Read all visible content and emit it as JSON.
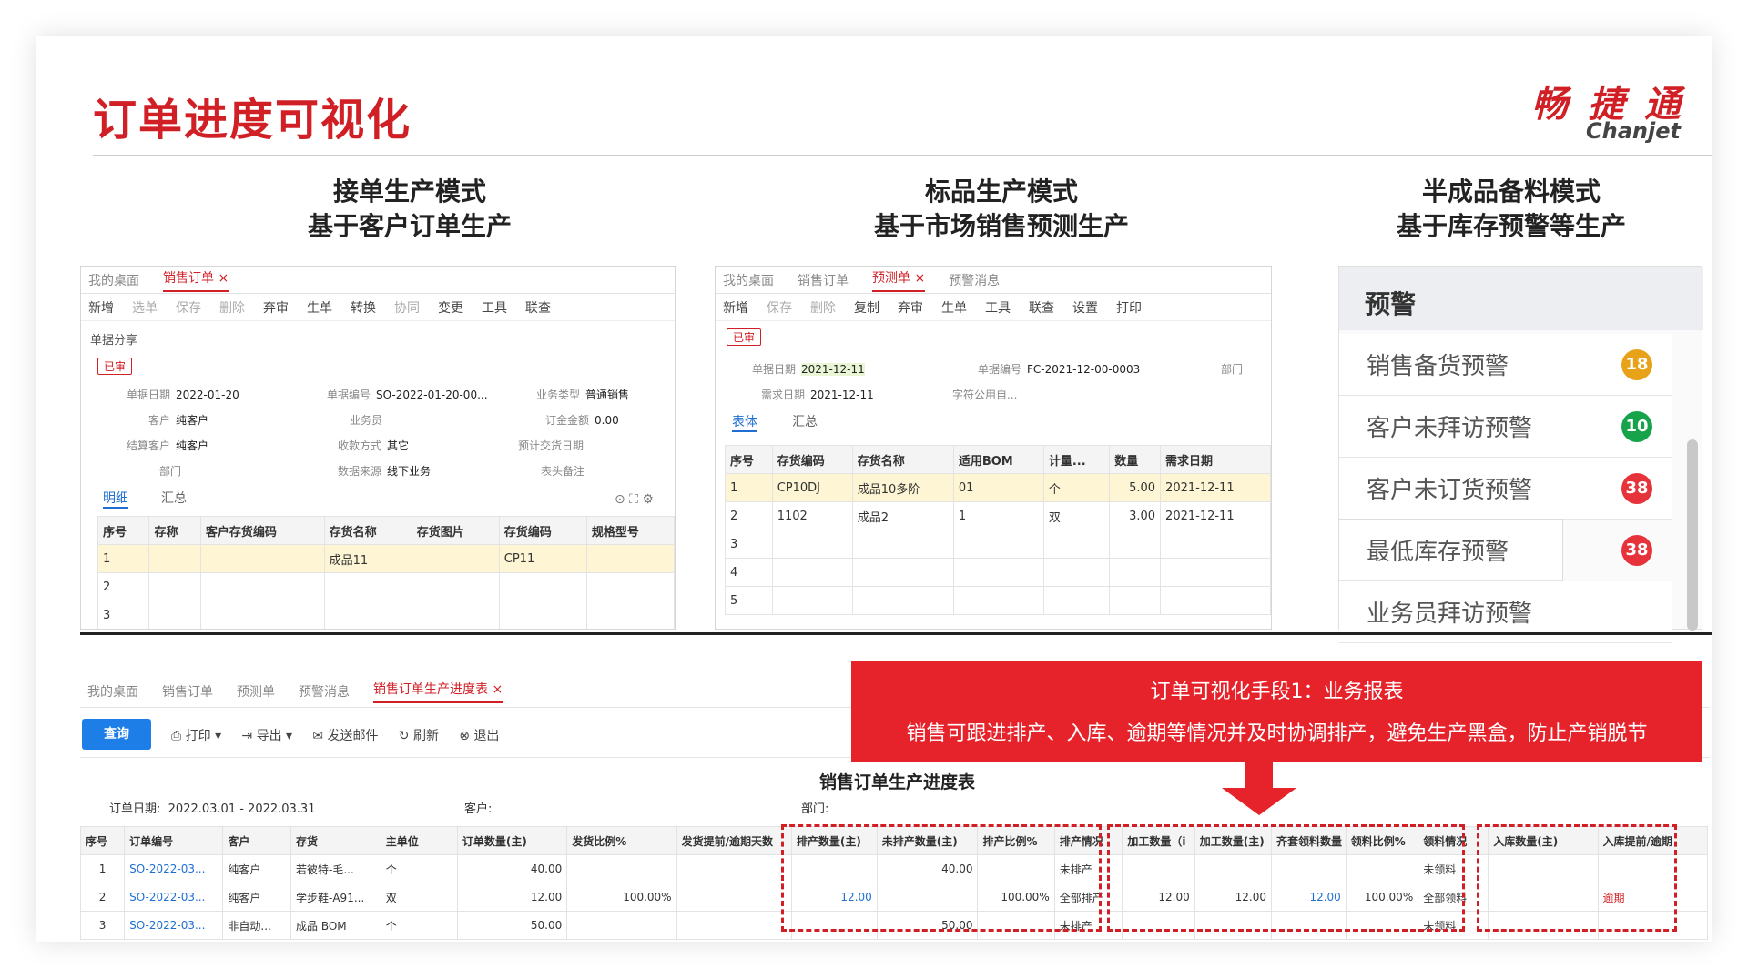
{
  "header": {
    "title": "订单进度可视化",
    "logo_cn": "畅 捷 通",
    "logo_en": "Chanjet"
  },
  "modes": [
    {
      "line1": "接单生产模式",
      "line2": "基于客户订单生产"
    },
    {
      "line1": "标品生产模式",
      "line2": "基于市场销售预测生产"
    },
    {
      "line1": "半成品备料模式",
      "line2": "基于库存预警等生产"
    }
  ],
  "sales_order": {
    "tabs": [
      "我的桌面",
      "销售订单"
    ],
    "toolbar": [
      "新增",
      "选单",
      "保存",
      "删除",
      "弃审",
      "生单",
      "转换",
      "协同",
      "变更",
      "工具",
      "联查"
    ],
    "share": "单据分享",
    "status": "已审",
    "fields": {
      "date_label": "单据日期",
      "date": "2022-01-20",
      "no_label": "单据编号",
      "no": "SO-2022-01-20-00...",
      "biz_label": "业务类型",
      "biz": "普通销售",
      "cust_label": "客户",
      "cust": "纯客户",
      "staff_label": "业务员",
      "deposit_label": "订金金额",
      "deposit": "0.00",
      "settle_label": "结算客户",
      "settle": "纯客户",
      "pay_label": "收款方式",
      "pay": "其它",
      "pdate_label": "预计交货日期",
      "dept_label": "部门",
      "src_label": "数据来源",
      "src": "线下业务",
      "remark_label": "表头备注"
    },
    "subtabs": [
      "明细",
      "汇总"
    ],
    "headers": [
      "序号",
      "存称",
      "客户存货编码",
      "存货名称",
      "存货图片",
      "存货编码",
      "规格型号"
    ],
    "rows": [
      [
        "1",
        "",
        "",
        "成品11",
        "",
        "CP11",
        ""
      ],
      [
        "2",
        "",
        "",
        "",
        "",
        "",
        ""
      ],
      [
        "3",
        "",
        "",
        "",
        "",
        "",
        ""
      ]
    ]
  },
  "forecast": {
    "tabs": [
      "我的桌面",
      "销售订单",
      "预测单",
      "预警消息"
    ],
    "toolbar": [
      "新增",
      "保存",
      "删除",
      "复制",
      "弃审",
      "生单",
      "工具",
      "联查",
      "设置",
      "打印"
    ],
    "status": "已审",
    "fields": {
      "date_label": "单据日期",
      "date": "2021-12-11",
      "no_label": "单据编号",
      "no": "FC-2021-12-00-0003",
      "dept_label": "部门",
      "need_label": "需求日期",
      "need": "2021-12-11",
      "char_label": "字符公用自..."
    },
    "subtabs": [
      "表体",
      "汇总"
    ],
    "headers": [
      "序号",
      "存货编码",
      "存货名称",
      "适用BOM",
      "计量...",
      "数量",
      "需求日期"
    ],
    "rows": [
      [
        "1",
        "CP10DJ",
        "成品10多阶",
        "01",
        "个",
        "5.00",
        "2021-12-11"
      ],
      [
        "2",
        "1102",
        "成品2",
        "1",
        "双",
        "3.00",
        "2021-12-11"
      ],
      [
        "3",
        "",
        "",
        "",
        "",
        "",
        ""
      ],
      [
        "4",
        "",
        "",
        "",
        "",
        "",
        ""
      ],
      [
        "5",
        "",
        "",
        "",
        "",
        "",
        ""
      ]
    ]
  },
  "alerts": {
    "title": "预警",
    "items": [
      {
        "label": "销售备货预警",
        "count": "18",
        "color": "#e8a21a"
      },
      {
        "label": "客户未拜访预警",
        "count": "10",
        "color": "#17a34a"
      },
      {
        "label": "客户未订货预警",
        "count": "38",
        "color": "#e6323a"
      },
      {
        "label": "最低库存预警",
        "count": "38",
        "color": "#e6323a"
      },
      {
        "label": "业务员拜访预警",
        "count": ""
      }
    ]
  },
  "report": {
    "tabs": [
      "我的桌面",
      "销售订单",
      "预测单",
      "预警消息",
      "销售订单生产进度表"
    ],
    "query": "查询",
    "toolbar": [
      "打印",
      "导出",
      "发送邮件",
      "刷新",
      "退出"
    ],
    "title": "销售订单生产进度表",
    "filters": {
      "date_label": "订单日期:",
      "date": "2022.03.01 - 2022.03.31",
      "cust_label": "客户:",
      "dept_label": "部门:"
    },
    "headers": [
      "序号",
      "订单编号",
      "客户",
      "存货",
      "主单位",
      "订单数量(主)",
      "发货比例%",
      "发货提前/逾期天数",
      "排产数量(主)",
      "未排产数量(主)",
      "排产比例%",
      "排产情况",
      "加工数量（i",
      "加工数量(主)",
      "齐套领料数量",
      "领料比例%",
      "领料情况",
      "入库数量(主)",
      "入库提前/逾期"
    ],
    "rows": [
      [
        "1",
        "SO-2022-03...",
        "纯客户",
        "若彼特-毛...",
        "个",
        "40.00",
        "",
        "",
        "",
        "40.00",
        "",
        "未排产",
        "",
        "",
        "",
        "",
        "未领料",
        "",
        ""
      ],
      [
        "2",
        "SO-2022-03...",
        "纯客户",
        "学步鞋-A91...",
        "双",
        "12.00",
        "100.00%",
        "",
        "12.00",
        "",
        "100.00%",
        "全部排产",
        "12.00",
        "12.00",
        "12.00",
        "100.00%",
        "全部领料",
        "",
        "逾期"
      ],
      [
        "3",
        "SO-2022-03...",
        "非自动...",
        "成品 BOM",
        "个",
        "50.00",
        "",
        "",
        "",
        "50.00",
        "",
        "未排产",
        "",
        "",
        "",
        "",
        "未领料",
        "",
        ""
      ]
    ]
  },
  "callout": {
    "line1": "订单可视化手段1：业务报表",
    "line2": "销售可跟进排产、入库、逾期等情况并及时协调排产，避免生产黑盒，防止产销脱节"
  }
}
